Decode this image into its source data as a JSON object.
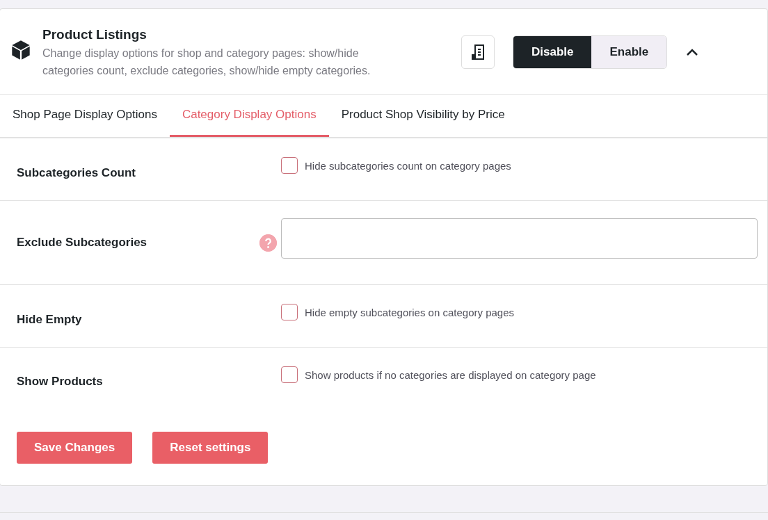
{
  "header": {
    "title": "Product Listings",
    "description": "Change display options for shop and category pages: show/hide categories count, exclude categories, show/hide empty categories.",
    "toggle": [
      {
        "label": "Disable",
        "selected": true
      },
      {
        "label": "Enable",
        "selected": false
      }
    ],
    "expanded": true
  },
  "tabs": [
    {
      "label": "Shop Page Display Options",
      "selected": false
    },
    {
      "label": "Category Display Options",
      "selected": true
    },
    {
      "label": "Product Shop Visibility by Price",
      "selected": false
    }
  ],
  "settings": [
    {
      "kind": "checkbox",
      "label": "Subcategories Count",
      "option": "Hide subcategories count on category pages",
      "checked": false
    },
    {
      "kind": "text",
      "label": "Exclude Subcategories"
    },
    {
      "kind": "checkbox",
      "label": "Hide Empty",
      "option": "Hide empty subcategories on category pages",
      "checked": false
    },
    {
      "kind": "checkbox",
      "label": "Show Products",
      "option": "Show products if no categories are displayed on category page",
      "checked": false
    }
  ],
  "buttons": [
    "Save Changes",
    "Reset settings"
  ]
}
